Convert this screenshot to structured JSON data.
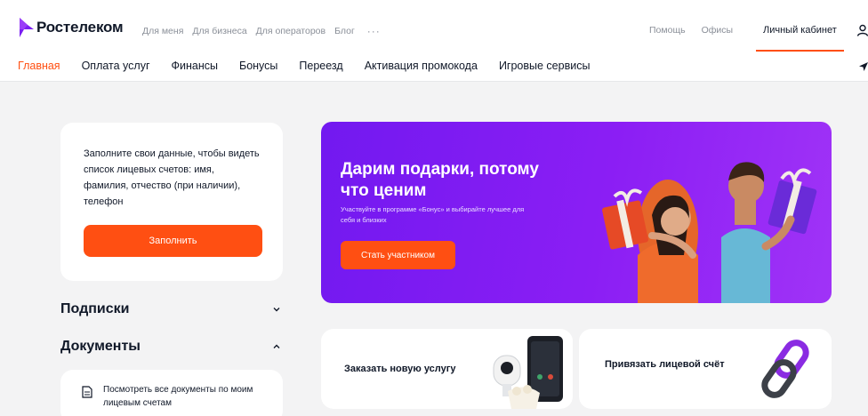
{
  "brand": {
    "name": "Ростелеком",
    "accent": "#ff4f12",
    "logo_color": "#7b1ff2"
  },
  "top_nav": {
    "items": [
      "Для меня",
      "Для бизнеса",
      "Для операторов",
      "Блог"
    ],
    "more_label": "···",
    "help": "Помощь",
    "offices": "Офисы",
    "cabinet": "Личный кабинет"
  },
  "sub_nav": {
    "items": [
      "Главная",
      "Оплата услуг",
      "Финансы",
      "Бонусы",
      "Переезд",
      "Активация промокода",
      "Игровые сервисы"
    ],
    "active_index": 0
  },
  "fill_card": {
    "text": "Заполните свои данные, чтобы видеть список лицевых счетов: имя, фамилия, отчество (при наличии), телефон",
    "button": "Заполнить"
  },
  "accordions": {
    "subscriptions": {
      "title": "Подписки",
      "state": "collapsed"
    },
    "documents": {
      "title": "Документы",
      "state": "expanded"
    }
  },
  "documents": {
    "link": "Посмотреть все документы по моим лицевым счетам"
  },
  "banner": {
    "title": "Дарим подарки, потому что ценим",
    "text": "Участвуйте в программе «Бонус» и выбирайте лучшее для себя и близких",
    "button": "Стать участником",
    "background": "#7b1ff2"
  },
  "services": {
    "order": {
      "title": "Заказать новую услугу"
    },
    "link_account": {
      "title": "Привязать лицевой счёт"
    }
  }
}
